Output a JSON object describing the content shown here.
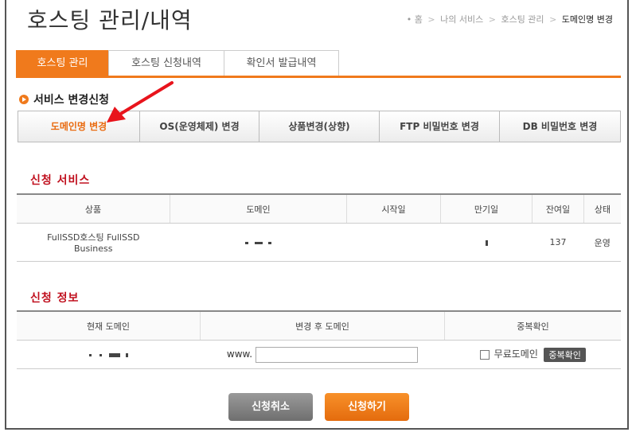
{
  "title": "호스팅 관리/내역",
  "breadcrumb": [
    "홈",
    "나의 서비스",
    "호스팅 관리",
    "도메인명 변경"
  ],
  "tabs": [
    {
      "label": "호스팅 관리",
      "active": true
    },
    {
      "label": "호스팅 신청내역",
      "active": false
    },
    {
      "label": "확인서 발급내역",
      "active": false
    }
  ],
  "service_change": {
    "heading": "서비스 변경신청",
    "buttons": [
      {
        "label": "도메인명 변경",
        "active": true
      },
      {
        "label": "OS(운영체제) 변경",
        "active": false
      },
      {
        "label": "상품변경(상향)",
        "active": false
      },
      {
        "label": "FTP 비밀번호 변경",
        "active": false
      },
      {
        "label": "DB 비밀번호 변경",
        "active": false
      }
    ]
  },
  "service_table": {
    "heading": "신청 서비스",
    "columns": [
      "상품",
      "도메인",
      "시작일",
      "만기일",
      "잔여일",
      "상태"
    ],
    "row": {
      "product_line1": "FullSSD호스팅 FullSSD",
      "product_line2": "Business",
      "remaining_days": "137",
      "status": "운영"
    }
  },
  "request_table": {
    "heading": "신청 정보",
    "columns": [
      "현재 도메인",
      "변경 후 도메인",
      "중복확인"
    ],
    "www_prefix": "www.",
    "new_domain_value": "",
    "free_domain_label": "무료도메인",
    "dup_check_label": "중복확인"
  },
  "buttons": {
    "cancel": "신청취소",
    "submit": "신청하기"
  },
  "colors": {
    "accent": "#f07a1c",
    "section_title": "#c0101e",
    "cancel_button": "#7f7f7f"
  }
}
